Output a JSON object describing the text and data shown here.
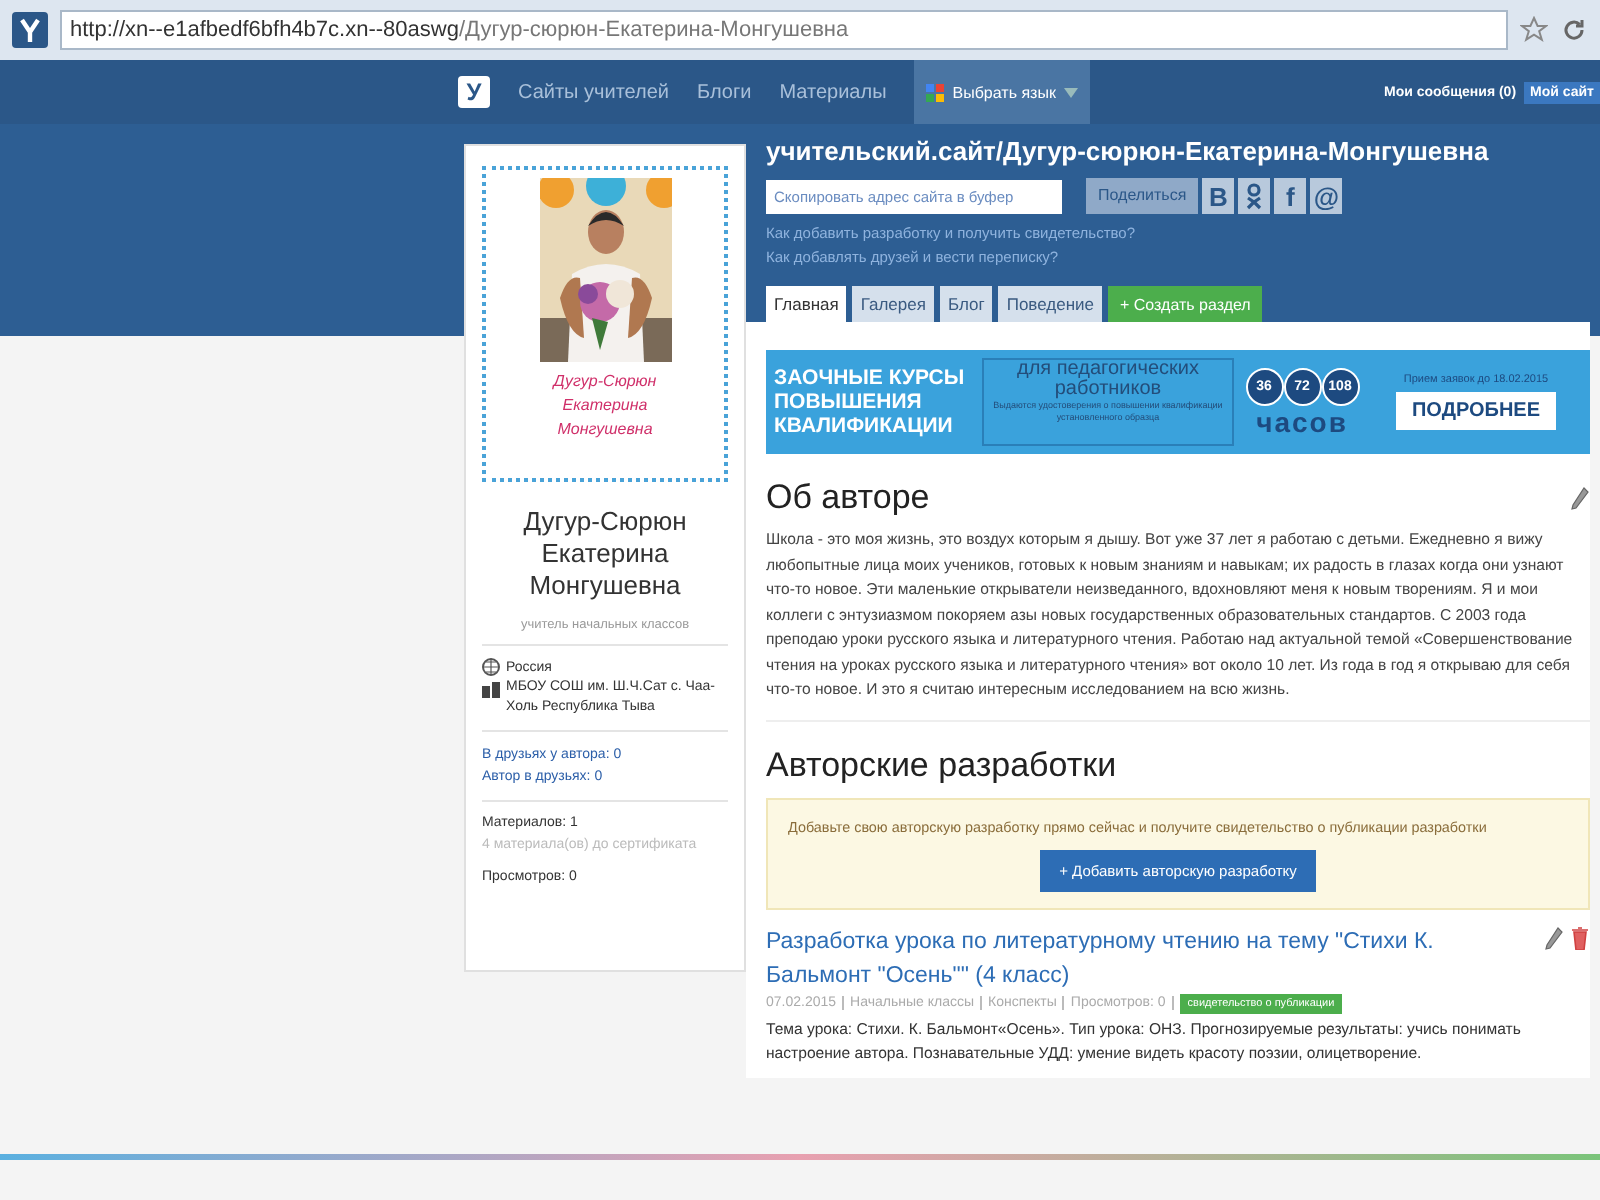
{
  "browser": {
    "url_host": "http://xn--e1afbedf6bfh4b7c.xn--80aswg",
    "url_path": "/Дугур-сюрюн-Екатерина-Монгушевна"
  },
  "nav": {
    "logo": "У",
    "items": [
      "Сайты учителей",
      "Блоги",
      "Материалы"
    ],
    "language": "Выбрать язык",
    "messages": "Мои сообщения (0)",
    "my_site": "Мой сайт"
  },
  "profile": {
    "caption": [
      "Дугур-Сюрюн",
      "Екатерина",
      "Монгушевна"
    ],
    "name": "Дугур-Сюрюн Екатерина Монгушевна",
    "role": "учитель начальных классов",
    "country": "Россия",
    "school": "МБОУ СОШ им. Ш.Ч.Сат с. Чаа-Холь Республика Тыва",
    "friends": [
      "В друзьях у автора: 0",
      "Автор в друзьях: 0"
    ],
    "materials": "Материалов: 1",
    "to_certificate": "4 материала(ов) до сертификата",
    "views": "Просмотров: 0"
  },
  "header": {
    "title": "учительский.сайт/Дугур-сюрюн-Екатерина-Монгушевна",
    "copy_button": "Скопировать адрес сайта в буфер",
    "share_label": "Поделиться",
    "share_buttons": [
      {
        "kind": "text",
        "label": "В"
      },
      {
        "kind": "icon"
      },
      {
        "kind": "text",
        "label": "f"
      },
      {
        "kind": "text",
        "label": "@"
      }
    ],
    "help_links": [
      "Как добавить разработку и получить свидетельство?",
      "Как добавлять друзей и вести переписку?"
    ],
    "tabs": [
      {
        "label": "Главная",
        "selected": true
      },
      {
        "label": "Галерея",
        "selected": false
      },
      {
        "label": "Блог",
        "selected": false
      },
      {
        "label": "Поведение",
        "selected": false
      }
    ],
    "create_button": "+ Создать раздел"
  },
  "banner": {
    "title": [
      "ЗАОЧНЫЕ КУРСЫ",
      "ПОВЫШЕНИЯ",
      "КВАЛИФИКАЦИИ"
    ],
    "audience": "для педагогических работников",
    "note": "Выдаются удостоверения о повышении квалификации установленного образца",
    "hours": [
      "36",
      "72",
      "108"
    ],
    "hours_label": "часов",
    "deadline": "Прием заявок до 18.02.2015",
    "button": "ПОДРОБНЕЕ"
  },
  "about": {
    "heading": "Об авторе",
    "text": "Школа - это моя жизнь, это воздух которым я дышу. Вот уже 37 лет я работаю с детьми. Ежедневно я вижу любопытные лица моих учеников, готовых к новым знаниям и навыкам; их радость в глазах когда они узнают что-то новое. Эти маленькие открыватели неизведанного, вдохновляют меня к новым творениям. Я и мои коллеги с энтузиазмом покоряем азы новых государственных образовательных стандартов. С 2003 года преподаю уроки русского языка и литературного чтения. Работаю над актуальной темой «Совершенствование чтения на уроках русского языка и литературного чтения» вот около 10 лет. Из года в год я открываю для себя что-то новое. И это я считаю интересным исследованием на всю жизнь."
  },
  "works": {
    "heading": "Авторские разработки",
    "prompt": "Добавьте свою авторскую разработку прямо сейчас и получите свидетельство о публикации разработки",
    "add_button": "+ Добавить авторскую разработку",
    "items": [
      {
        "title": "Разработка урока по литературному чтению на тему \"Стихи К. Бальмонт \"Осень\"\" (4 класс)",
        "meta": [
          "07.02.2015",
          "Начальные классы",
          "Конспекты",
          "Просмотров: 0"
        ],
        "badge": "свидетельство о публикации",
        "description": "Тема урока: Стихи. К. Бальмонт«Осень». Тип урока: ОНЗ. Прогнозируемые результаты: учись понимать настроение автора. Познавательные УДД: умение видеть красоту поэзии, олицетворение."
      }
    ]
  }
}
